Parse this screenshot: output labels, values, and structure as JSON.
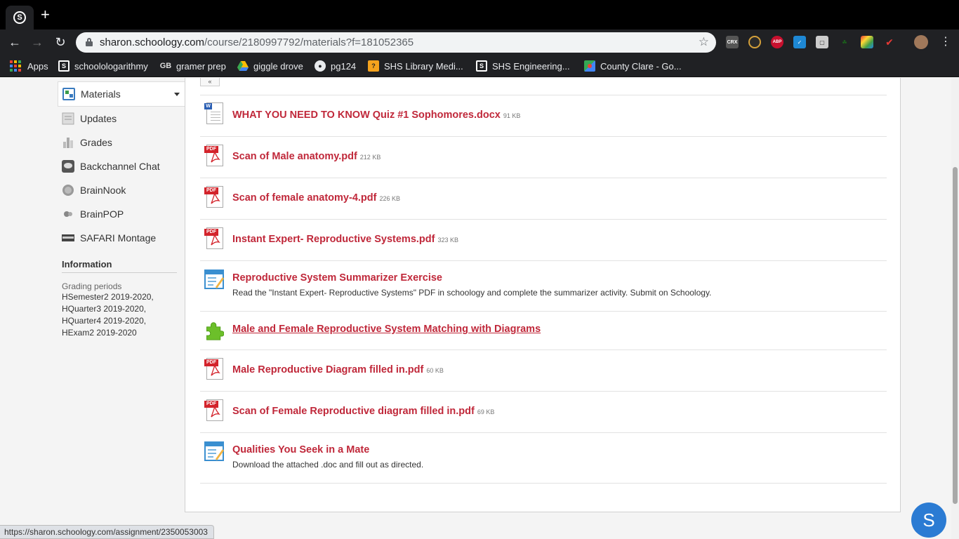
{
  "browser": {
    "tab_icon": "schoology-s-icon",
    "new_tab_symbol": "+",
    "url_host": "sharon.schoology.com",
    "url_path": "/course/2180997792/materials?f=181052365",
    "extensions": [
      "CRX",
      "ABP"
    ],
    "bookmarks": [
      {
        "label": "Apps",
        "icon": "apps-grid-icon"
      },
      {
        "label": "schoolologarithmy",
        "icon": "schoology-s-icon"
      },
      {
        "label": "gramer prep",
        "icon": "gb-icon",
        "icon_text": "GB"
      },
      {
        "label": "giggle drove",
        "icon": "google-drive-icon"
      },
      {
        "label": "pg124",
        "icon": "globe-icon"
      },
      {
        "label": "SHS Library Medi...",
        "icon": "library-icon"
      },
      {
        "label": "SHS Engineering...",
        "icon": "schoology-s-icon"
      },
      {
        "label": "County Clare - Go...",
        "icon": "google-maps-icon"
      }
    ]
  },
  "sidebar": {
    "nav": [
      {
        "label": "Materials",
        "icon": "materials-icon",
        "active": true
      },
      {
        "label": "Updates",
        "icon": "updates-icon"
      },
      {
        "label": "Grades",
        "icon": "grades-icon"
      },
      {
        "label": "Backchannel Chat",
        "icon": "chat-icon"
      },
      {
        "label": "BrainNook",
        "icon": "brainnook-icon"
      },
      {
        "label": "BrainPOP",
        "icon": "brainpop-icon"
      },
      {
        "label": "SAFARI Montage",
        "icon": "safari-montage-icon"
      }
    ],
    "info_title": "Information",
    "grading_label": "Grading periods",
    "grading_values": [
      "HSemester2 2019-2020,",
      "HQuarter3 2019-2020,",
      "HQuarter4 2019-2020,",
      "HExam2 2019-2020"
    ]
  },
  "top_button_symbol": "«",
  "materials": [
    {
      "type": "word",
      "title": "WHAT YOU NEED TO KNOW Quiz #1 Sophomores.docx",
      "size": "91 KB"
    },
    {
      "type": "pdf",
      "title": "Scan of Male anatomy.pdf",
      "size": "212 KB"
    },
    {
      "type": "pdf",
      "title": "Scan of female anatomy-4.pdf",
      "size": "226 KB"
    },
    {
      "type": "pdf",
      "title": "Instant Expert- Reproductive Systems.pdf",
      "size": "323 KB"
    },
    {
      "type": "assignment",
      "title": "Reproductive System Summarizer Exercise",
      "description": "Read the \"Instant Expert- Reproductive Systems\" PDF in schoology and complete the summarizer activity. Submit on Schoology."
    },
    {
      "type": "external",
      "title": "Male and Female Reproductive System Matching with Diagrams",
      "underlined": true
    },
    {
      "type": "pdf",
      "title": "Male Reproductive Diagram filled in.pdf",
      "size": "60 KB"
    },
    {
      "type": "pdf",
      "title": "Scan of Female Reproductive diagram filled in.pdf",
      "size": "69 KB"
    },
    {
      "type": "assignment",
      "title": "Qualities You Seek in a Mate",
      "description": "Download the attached .doc and fill out as directed."
    }
  ],
  "status_url": "https://sharon.schoology.com/assignment/2350053003",
  "fab_label": "S",
  "colors": {
    "link": "#c0283a",
    "pdf": "#d3232b",
    "fab": "#2b7bd3"
  }
}
